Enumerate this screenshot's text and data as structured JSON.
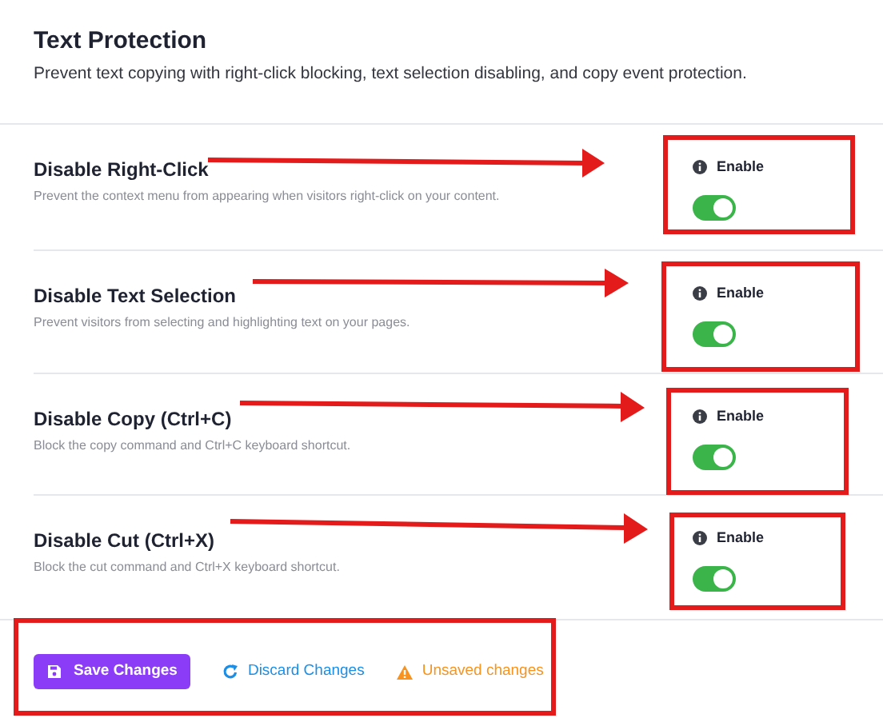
{
  "header": {
    "title": "Text Protection",
    "description": "Prevent text copying with right-click blocking, text selection disabling, and copy event protection."
  },
  "settings": [
    {
      "title": "Disable Right-Click",
      "description": "Prevent the context menu from appearing when visitors right-click on your content.",
      "toggle_label": "Enable",
      "on": true
    },
    {
      "title": "Disable Text Selection",
      "description": "Prevent visitors from selecting and highlighting text on your pages.",
      "toggle_label": "Enable",
      "on": true
    },
    {
      "title": "Disable Copy (Ctrl+C)",
      "description": "Block the copy command and Ctrl+C keyboard shortcut.",
      "toggle_label": "Enable",
      "on": true
    },
    {
      "title": "Disable Cut (Ctrl+X)",
      "description": "Block the cut command and Ctrl+X keyboard shortcut.",
      "toggle_label": "Enable",
      "on": true
    }
  ],
  "footer": {
    "save_button": "Save Changes",
    "discard_button": "Discard Changes",
    "status": "Unsaved changes"
  }
}
